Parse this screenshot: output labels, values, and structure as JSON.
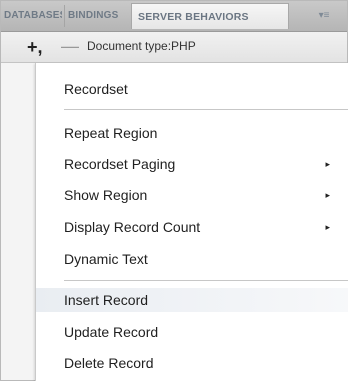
{
  "tabs": [
    {
      "label": "DATABASES",
      "active": false
    },
    {
      "label": "BINDINGS",
      "active": false
    },
    {
      "label": "SERVER BEHAVIORS",
      "active": true
    }
  ],
  "tab_menu_glyph": "▾≡",
  "toolbar": {
    "add_glyph": "+,",
    "remove_glyph": "—",
    "document_type": "Document type:PHP"
  },
  "menu": {
    "items": [
      {
        "label": "Recordset",
        "has_submenu": false
      },
      {
        "label": "Repeat Region",
        "has_submenu": false
      },
      {
        "label": "Recordset Paging",
        "has_submenu": true
      },
      {
        "label": "Show Region",
        "has_submenu": true
      },
      {
        "label": "Display Record Count",
        "has_submenu": true
      },
      {
        "label": "Dynamic Text",
        "has_submenu": false
      },
      {
        "label": "Insert Record",
        "has_submenu": false,
        "highlighted": true
      },
      {
        "label": "Update Record",
        "has_submenu": false
      },
      {
        "label": "Delete Record",
        "has_submenu": false
      }
    ],
    "submenu_arrow": "▸"
  },
  "colors": {
    "tab_text": "#6f7a86",
    "menu_bg": "#ffffff",
    "highlight": "#e9edf2"
  }
}
